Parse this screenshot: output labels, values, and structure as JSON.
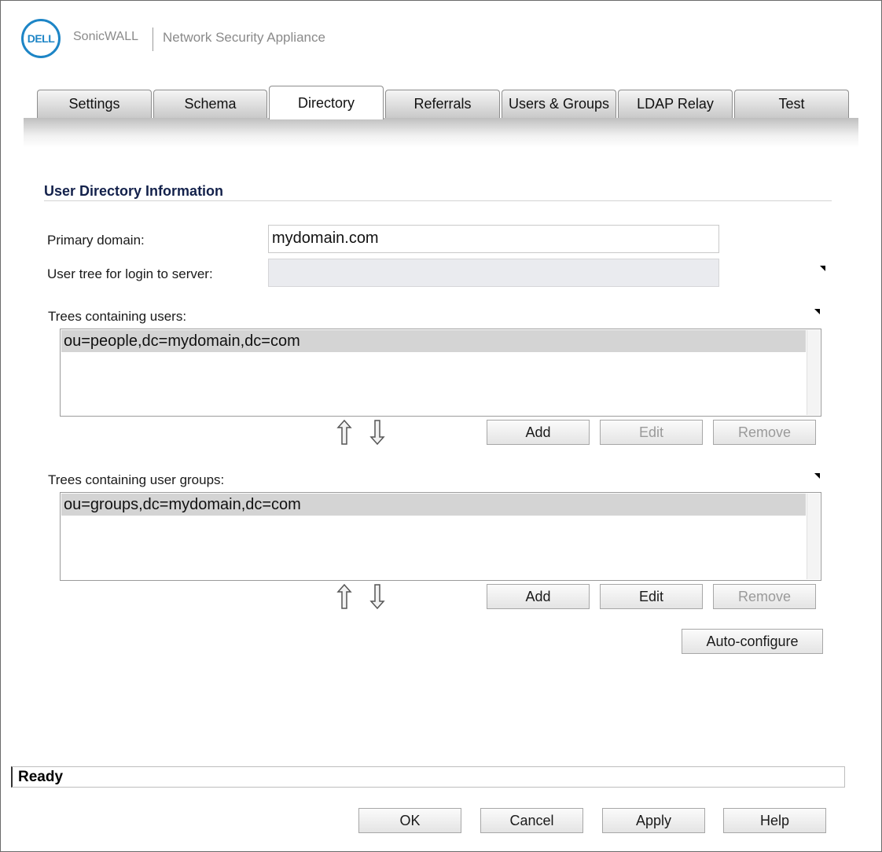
{
  "header": {
    "logo_text": "DELL",
    "brand": "SonicWALL",
    "product": "Network Security Appliance",
    "brand_color": "#1d85c6"
  },
  "tabs": [
    {
      "label": "Settings",
      "active": false
    },
    {
      "label": "Schema",
      "active": false
    },
    {
      "label": "Directory",
      "active": true
    },
    {
      "label": "Referrals",
      "active": false
    },
    {
      "label": "Users & Groups",
      "active": false
    },
    {
      "label": "LDAP Relay",
      "active": false
    },
    {
      "label": "Test",
      "active": false
    }
  ],
  "section": {
    "title": "User Directory Information",
    "primary_domain_label": "Primary domain:",
    "primary_domain_value": "mydomain.com",
    "user_tree_label": "User tree for login to server:",
    "user_tree_value": ""
  },
  "users_trees": {
    "label": "Trees containing users:",
    "items": [
      "ou=people,dc=mydomain,dc=com"
    ],
    "move_up_icon": "arrow-up-icon",
    "move_down_icon": "arrow-down-icon",
    "add_label": "Add",
    "edit_label": "Edit",
    "remove_label": "Remove",
    "edit_enabled": false,
    "remove_enabled": false
  },
  "group_trees": {
    "label": "Trees containing user groups:",
    "items": [
      "ou=groups,dc=mydomain,dc=com"
    ],
    "move_up_icon": "arrow-up-icon",
    "move_down_icon": "arrow-down-icon",
    "add_label": "Add",
    "edit_label": "Edit",
    "remove_label": "Remove",
    "edit_enabled": true,
    "remove_enabled": false
  },
  "auto_configure_label": "Auto-configure",
  "status": "Ready",
  "footer": {
    "ok_label": "OK",
    "cancel_label": "Cancel",
    "apply_label": "Apply",
    "help_label": "Help"
  }
}
